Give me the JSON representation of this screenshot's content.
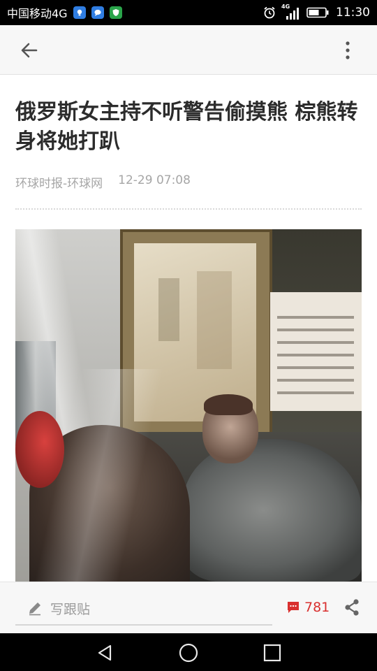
{
  "status_bar": {
    "carrier": "中国移动4G",
    "network_type": "4G",
    "time": "11:30",
    "notification_icons": [
      "lightbulb-app-icon",
      "chat-bubble-app-icon",
      "shield-app-icon"
    ],
    "notification_colors": [
      "#2f7de1",
      "#2f7de1",
      "#2aa44a"
    ]
  },
  "app_bar": {
    "back_icon": "arrow-left-icon",
    "more_icon": "more-vertical-icon"
  },
  "article": {
    "title": "俄罗斯女主持不听警告偷摸熊 棕熊转身将她打趴",
    "source": "环球时报-环球网",
    "time": "12-29 07:08"
  },
  "comment_bar": {
    "placeholder": "写跟贴",
    "comment_count": "781",
    "accent_color": "#d9302f"
  },
  "nav_bar": {
    "icons": [
      "triangle-back-icon",
      "circle-home-icon",
      "square-recent-icon"
    ]
  }
}
